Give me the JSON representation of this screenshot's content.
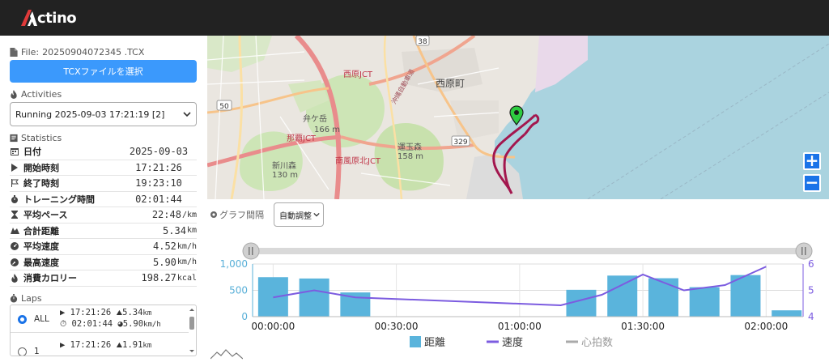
{
  "app": {
    "logo_text": "ctino"
  },
  "file": {
    "label": "File:",
    "name": "20250904072345 .TCX",
    "button_label": "TCXファイルを選択"
  },
  "activities": {
    "title": "Activities",
    "selected": "Running 2025-09-03 17:21:19 [2]"
  },
  "statistics": {
    "title": "Statistics",
    "rows": [
      {
        "icon": "calendar-icon",
        "label": "日付",
        "value": "2025-09-03",
        "unit": ""
      },
      {
        "icon": "play-icon",
        "label": "開始時刻",
        "value": "17:21:26",
        "unit": ""
      },
      {
        "icon": "flag-icon",
        "label": "終了時刻",
        "value": "19:23:10",
        "unit": ""
      },
      {
        "icon": "stopwatch-icon",
        "label": "トレーニング時間",
        "value": "02:01:44",
        "unit": ""
      },
      {
        "icon": "hourglass-icon",
        "label": "平均ペース",
        "value": "22:48",
        "unit": "/km"
      },
      {
        "icon": "route-icon",
        "label": "合計距離",
        "value": "5.34",
        "unit": "km"
      },
      {
        "icon": "gauge-icon",
        "label": "平均速度",
        "value": "4.52",
        "unit": "km/h"
      },
      {
        "icon": "speedometer-icon",
        "label": "最高速度",
        "value": "5.90",
        "unit": "km/h"
      },
      {
        "icon": "fire-icon",
        "label": "消費カロリー",
        "value": "198.27",
        "unit": "kcal"
      }
    ]
  },
  "laps": {
    "title": "Laps",
    "items": [
      {
        "name": "ALL",
        "selected": true,
        "start": "17:21:26",
        "distance": "5.34",
        "distance_unit": "km",
        "duration": "02:01:44",
        "speed": "5.90",
        "speed_unit": "km/h"
      },
      {
        "name": "1",
        "selected": false,
        "start": "17:21:26",
        "distance": "1.91",
        "distance_unit": "km",
        "duration": "",
        "speed": "",
        "speed_unit": ""
      }
    ]
  },
  "map": {
    "labels": {
      "route_38": "38",
      "route_329": "329",
      "route_50": "50",
      "nishihara_town": "西原町",
      "nishihara_jct": "西原JCT",
      "naha_jct": "那覇JCT",
      "minami_haebaru_kita_jct": "南風原北JCT",
      "uenodake": "弁ケ岳",
      "uenodake_elev": "166 m",
      "untamamori": "運玉森",
      "untamamori_elev": "158 m",
      "shinkawa_mori": "新川森",
      "shinkawa_elev": "130 m",
      "expressway": "沖縄自動車道"
    },
    "zoom_in": "+",
    "zoom_out": "−",
    "route_color": "#a3174e",
    "marker_color": "#2ecc40"
  },
  "graph": {
    "interval_label": "グラフ間隔",
    "interval_value": "自動調整"
  },
  "chart_data": {
    "type": "bar",
    "x_ticks": [
      "00:00:00",
      "00:30:00",
      "01:00:00",
      "01:30:00",
      "02:00:00"
    ],
    "x_tick_minutes": [
      0,
      30,
      60,
      90,
      120
    ],
    "xlim_minutes": [
      -5,
      129
    ],
    "y_left": {
      "ticks": [
        "0",
        "500",
        "1,000"
      ],
      "ylim": [
        0,
        1000
      ],
      "color": "#5ab0d8"
    },
    "y_right": {
      "ticks": [
        "4",
        "5",
        "6"
      ],
      "ylim": [
        4,
        6
      ],
      "color": "#7c5ce0"
    },
    "series": [
      {
        "name": "距離",
        "type": "bar",
        "color": "#5ab4dc",
        "x_minutes": [
          0,
          10,
          20,
          75,
          85,
          95,
          105,
          115,
          125
        ],
        "values": [
          750,
          725,
          460,
          510,
          780,
          730,
          560,
          790,
          120
        ]
      },
      {
        "name": "速度",
        "type": "line",
        "color": "#7c5ce0",
        "x_minutes": [
          0,
          10,
          20,
          70,
          80,
          90,
          100,
          110,
          120
        ],
        "values": [
          4.73,
          5.0,
          4.73,
          4.43,
          4.83,
          5.6,
          5.0,
          5.2,
          5.9
        ]
      },
      {
        "name": "心拍数",
        "type": "line",
        "color": "#aaaaaa",
        "x_minutes": [],
        "values": []
      }
    ],
    "legend_position": "bottom"
  }
}
